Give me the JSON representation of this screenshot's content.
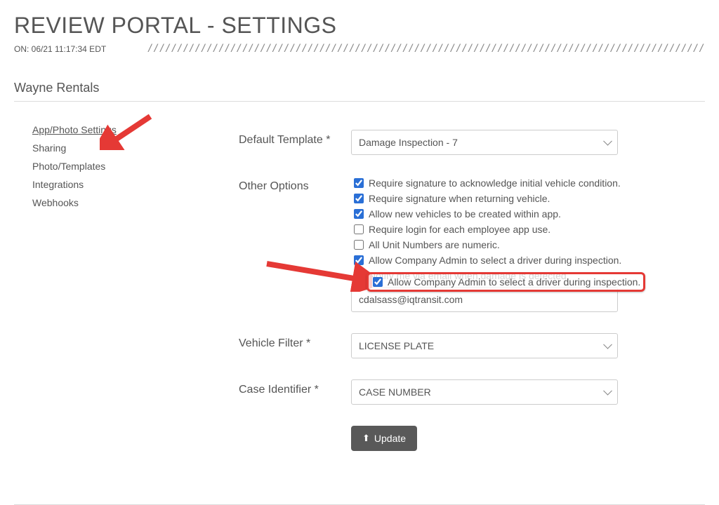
{
  "header": {
    "title": "REVIEW PORTAL - SETTINGS",
    "timestamp": "ON: 06/21 11:17:34 EDT"
  },
  "company": "Wayne Rentals",
  "sidebar": {
    "items": [
      {
        "label": "App/Photo Settings",
        "active": true
      },
      {
        "label": "Sharing",
        "active": false
      },
      {
        "label": "Photo/Templates",
        "active": false
      },
      {
        "label": "Integrations",
        "active": false
      },
      {
        "label": "Webhooks",
        "active": false
      }
    ]
  },
  "form": {
    "default_template": {
      "label": "Default Template *",
      "selected": "Damage Inspection - 7"
    },
    "other_options": {
      "label": "Other Options",
      "items": [
        {
          "label": "Require signature to acknowledge initial vehicle condition.",
          "checked": true
        },
        {
          "label": "Require signature when returning vehicle.",
          "checked": true
        },
        {
          "label": "Allow new vehicles to be created within app.",
          "checked": true
        },
        {
          "label": "Require login for each employee app use.",
          "checked": false
        },
        {
          "label": "All Unit Numbers are numeric.",
          "checked": false
        },
        {
          "label": "Allow Company Admin to select a driver during inspection.",
          "checked": true
        },
        {
          "label": "Notify me via email when damage is detected.",
          "checked": true
        }
      ],
      "email_value": "cdalsass@iqtransit.com"
    },
    "vehicle_filter": {
      "label": "Vehicle Filter *",
      "selected": "LICENSE PLATE"
    },
    "case_identifier": {
      "label": "Case Identifier *",
      "selected": "CASE NUMBER"
    },
    "update_button": "Update"
  }
}
